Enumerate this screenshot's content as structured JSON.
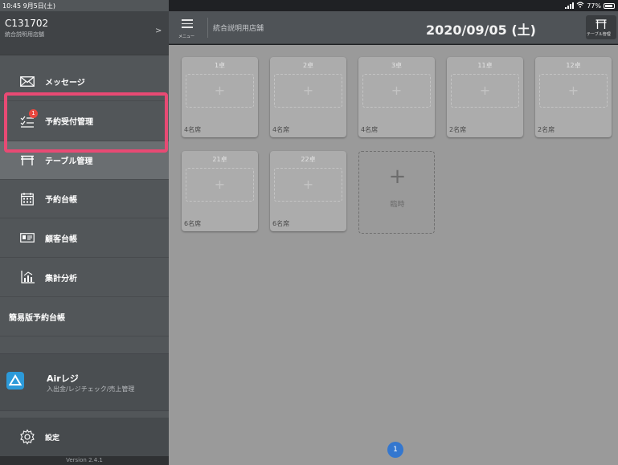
{
  "status": {
    "time_date": "10:45  9月5日(土)",
    "battery": "77%"
  },
  "sidebar": {
    "store_code": "C131702",
    "store_name": "統合説明用店舗",
    "items": [
      {
        "label": "メッセージ",
        "icon": "envelope-icon"
      },
      {
        "label": "予約受付管理",
        "icon": "checklist-icon",
        "badge": "1"
      },
      {
        "label": "テーブル管理",
        "icon": "table-icon"
      },
      {
        "label": "予約台帳",
        "icon": "calendar-icon"
      },
      {
        "label": "顧客台帳",
        "icon": "id-card-icon"
      },
      {
        "label": "集計分析",
        "icon": "chart-icon"
      },
      {
        "label": "簡易版予約台帳"
      }
    ],
    "air_app": {
      "name": "Airレジ",
      "description": "入出金/レジチェック/売上管理"
    },
    "settings_label": "設定",
    "version": "Version 2.4.1"
  },
  "topbar": {
    "menu_label": "メニュー",
    "store_name": "統合説明用店舗",
    "date": "2020/09/05 (土)",
    "table_manage_label": "テーブル管理"
  },
  "tables": [
    {
      "name": "1卓",
      "seats": "4名席"
    },
    {
      "name": "2卓",
      "seats": "4名席"
    },
    {
      "name": "3卓",
      "seats": "4名席"
    },
    {
      "name": "11卓",
      "seats": "2名席"
    },
    {
      "name": "12卓",
      "seats": "2名席"
    },
    {
      "name": "21卓",
      "seats": "6名席"
    },
    {
      "name": "22卓",
      "seats": "6名席"
    }
  ],
  "slot_plus": "+",
  "temporary": {
    "plus": "+",
    "label": "臨時"
  },
  "pager": {
    "current": "1"
  },
  "colors": {
    "highlight": "#e84a74",
    "badge": "#e8473f",
    "accent": "#3477cf",
    "airregi": "#2c9ad9"
  }
}
